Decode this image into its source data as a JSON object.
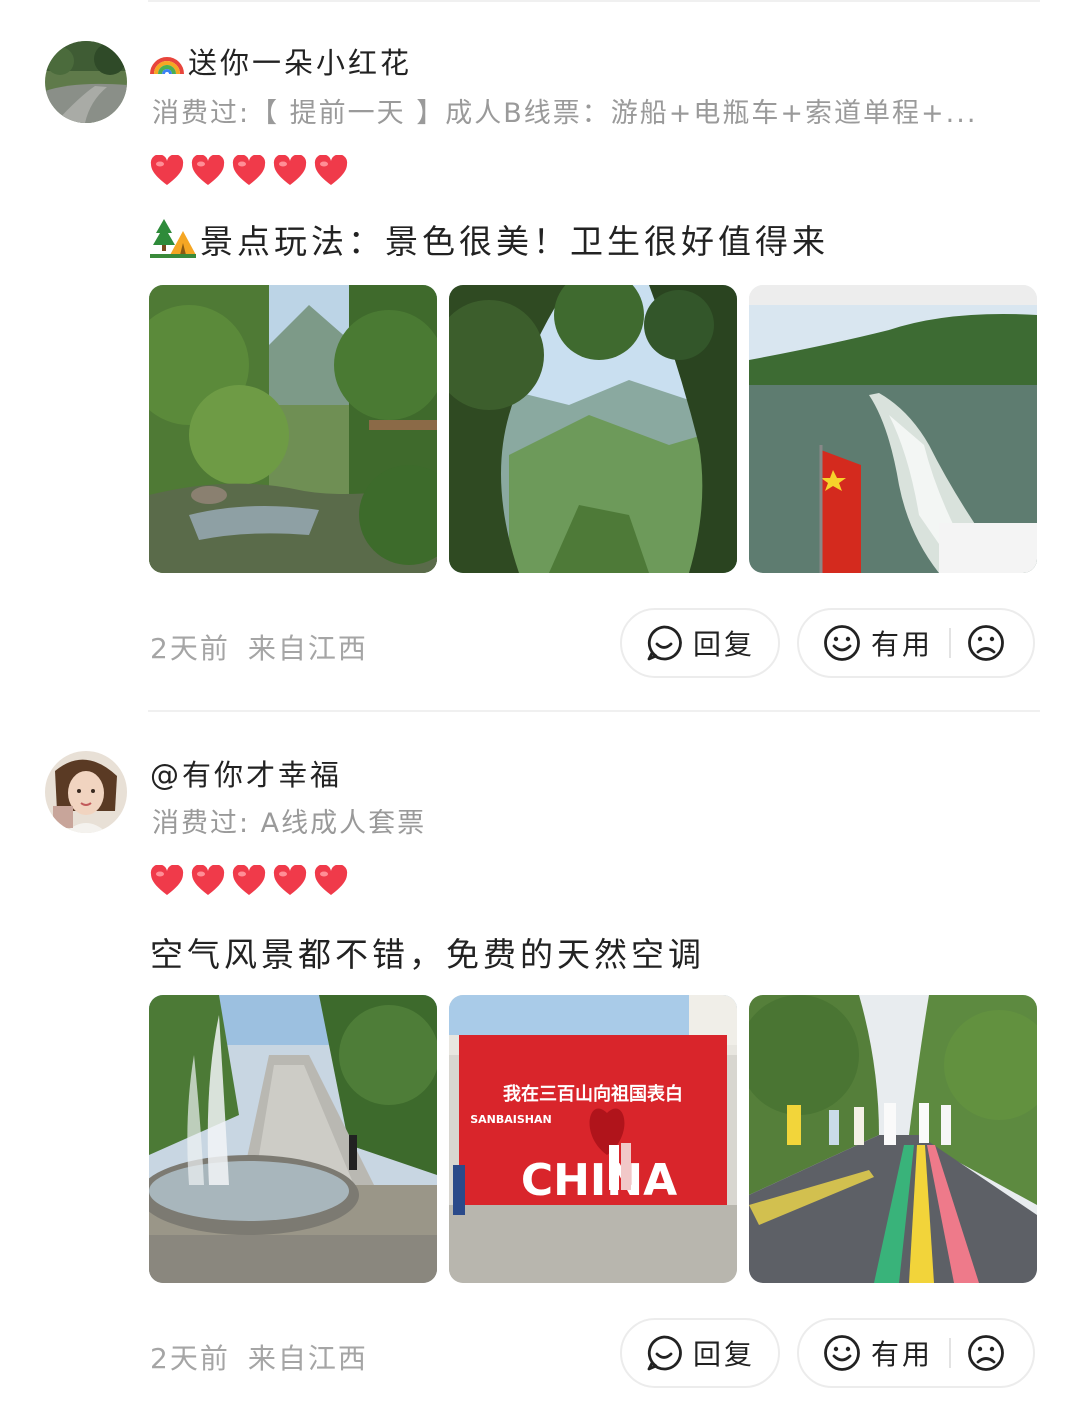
{
  "reviews": [
    {
      "username": "送你一朵小红花",
      "username_emoji": "rainbow-icon",
      "consumed": "消费过:【 提前一天 】成人B线票：游船+电瓶车+索道单程+...",
      "rating": 5,
      "content_emoji": "camping-icon",
      "content": "景点玩法：景色很美！卫生很好值得来",
      "photos": [
        "mountain-stream-photo",
        "valley-view-photo",
        "boat-lake-photo"
      ],
      "time": "2天前",
      "location": "来自江西",
      "reply_label": "回复",
      "useful_label": "有用"
    },
    {
      "username": "@有你才幸福",
      "consumed": "消费过: A线成人套票",
      "rating": 5,
      "content": "空气风景都不错，免费的天然空调",
      "photos": [
        "fountain-stairs-photo",
        "red-billboard-photo",
        "walking-road-photo"
      ],
      "photo_texts": {
        "billboard_title": "我在三百山向祖国表白",
        "billboard_sub": "SANBAISHAN",
        "billboard_china": "CHINA"
      },
      "time": "2天前",
      "location": "来自江西",
      "reply_label": "回复",
      "useful_label": "有用"
    }
  ],
  "colors": {
    "heart": "#f03a4a",
    "muted_text": "#9a9a9a",
    "border": "#ececec"
  }
}
